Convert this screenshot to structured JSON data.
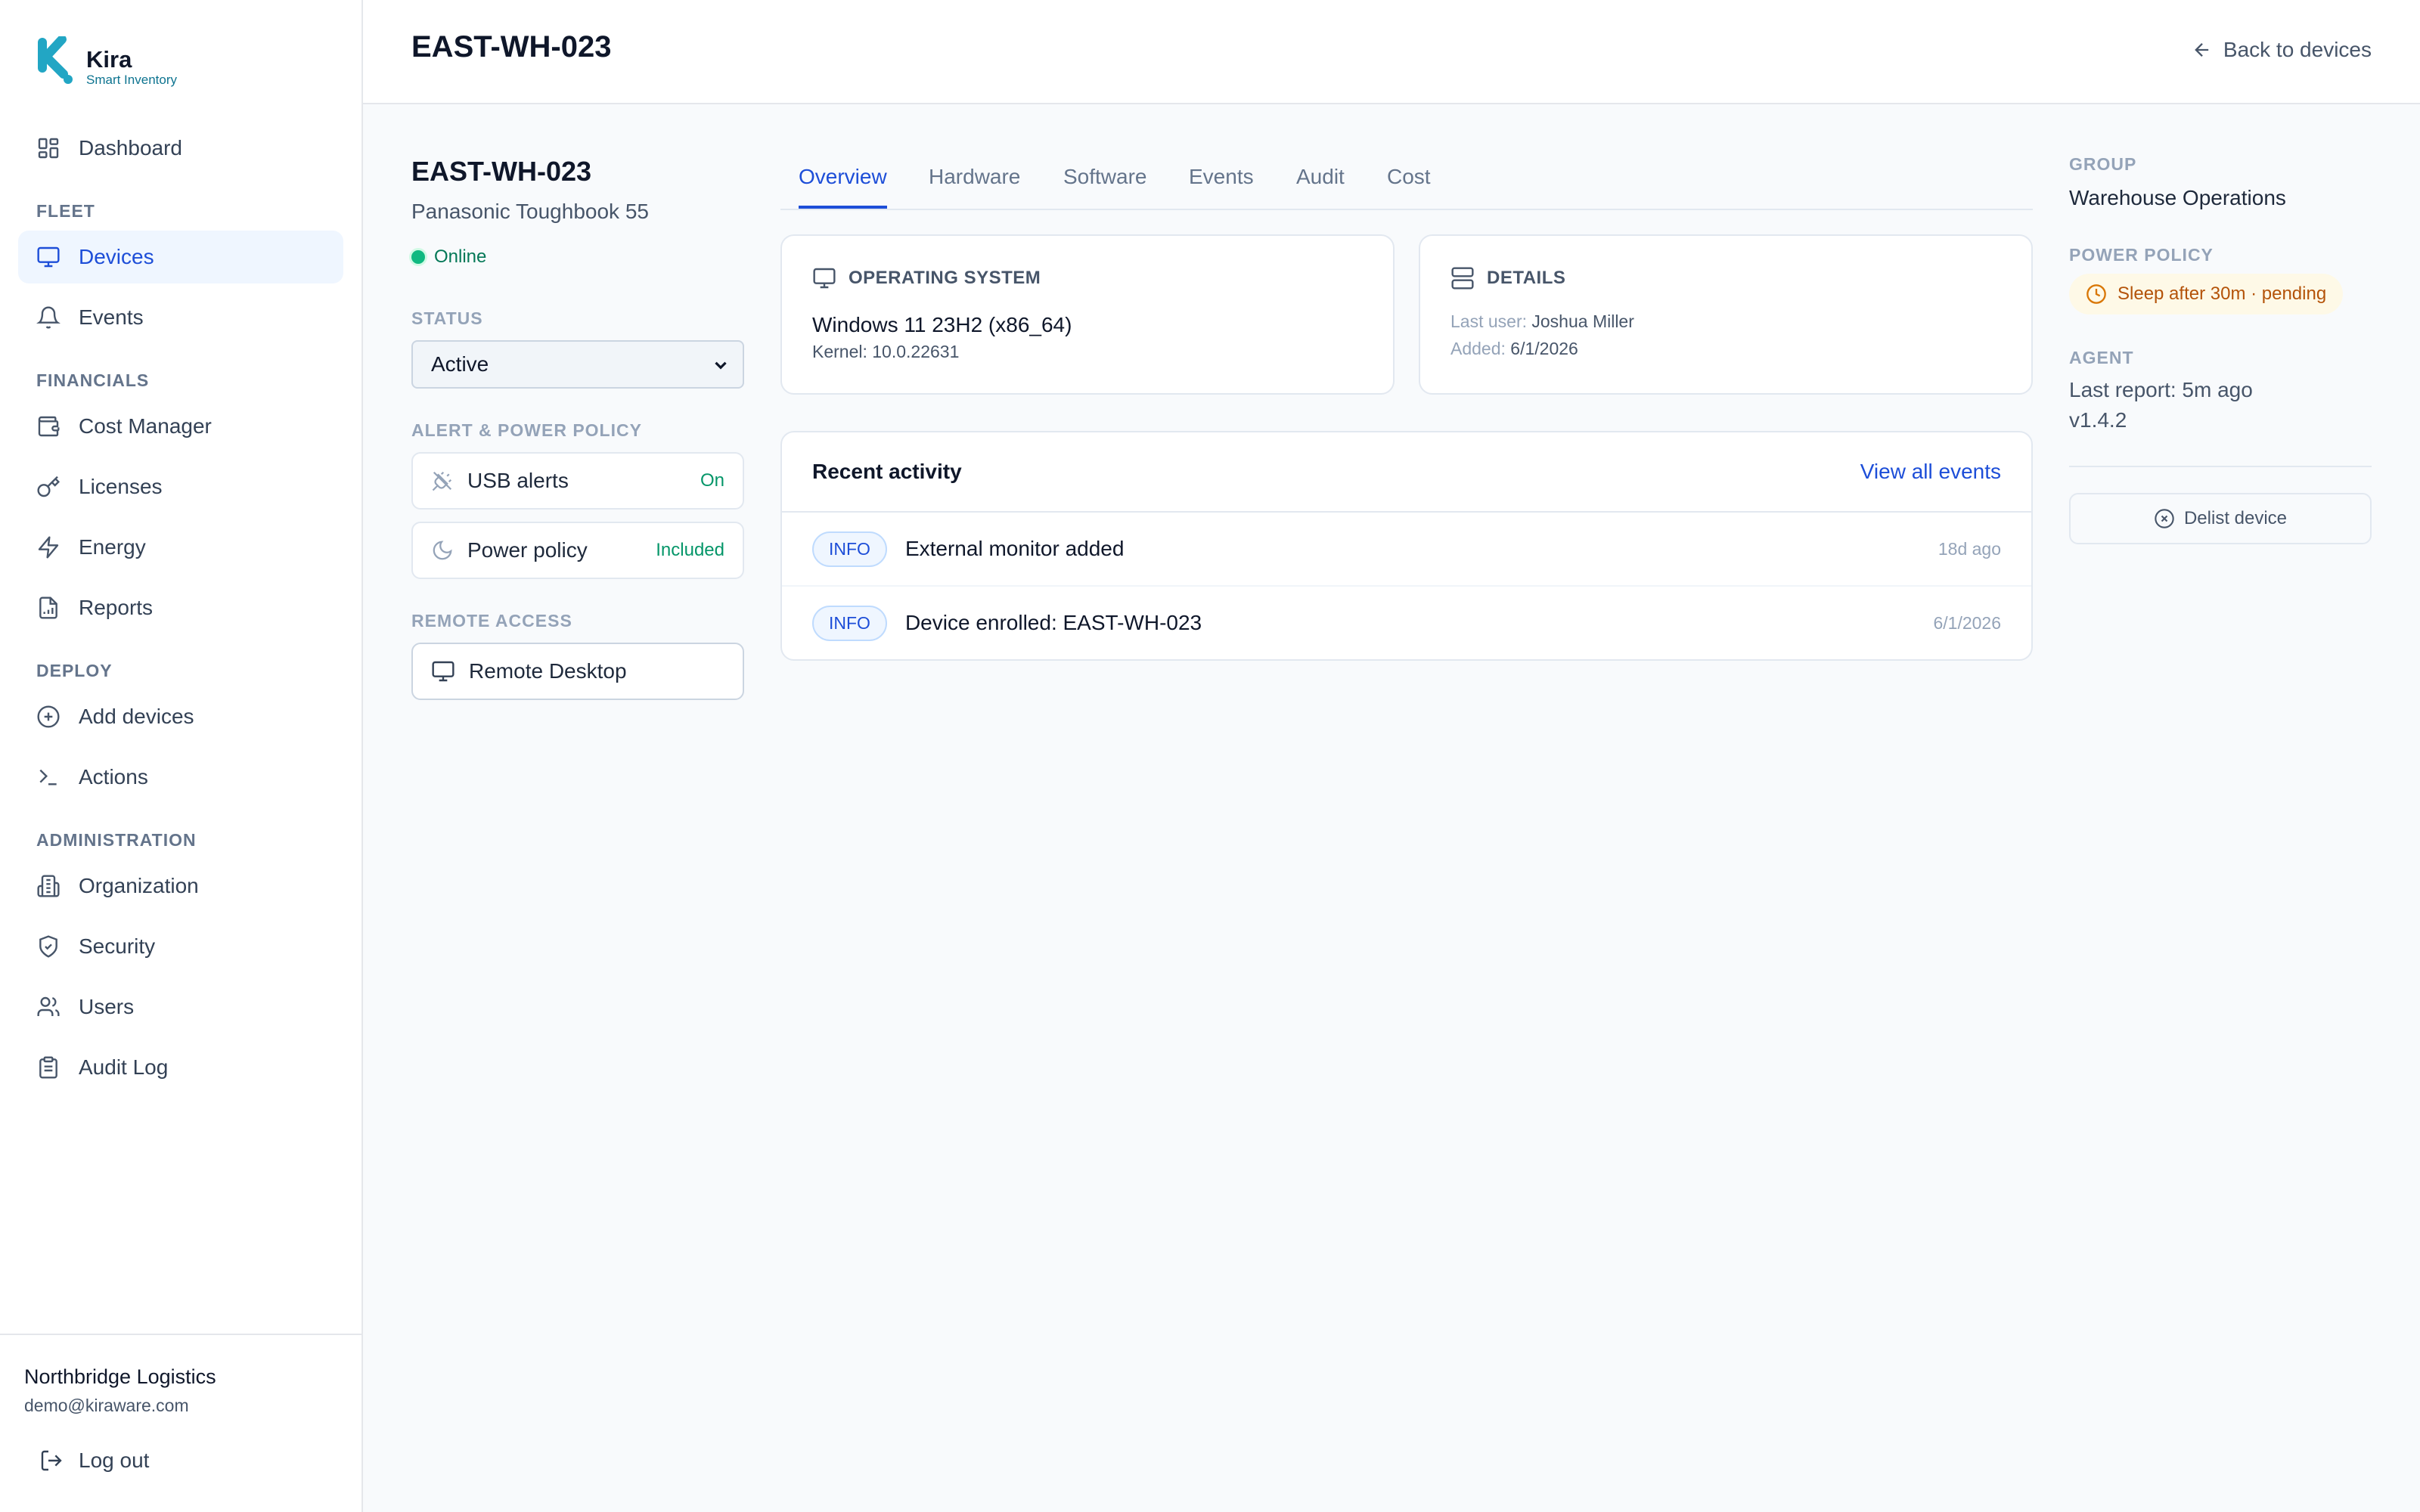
{
  "brand": {
    "name": "Kira",
    "tagline": "Smart Inventory",
    "accent": "#22a6c4"
  },
  "sidebar": {
    "items": [
      {
        "label": "Dashboard",
        "icon": "dashboard-icon"
      },
      {
        "label": "Devices",
        "icon": "monitor-icon",
        "active": true
      },
      {
        "label": "Events",
        "icon": "bell-icon"
      },
      {
        "label": "Cost Manager",
        "icon": "wallet-icon"
      },
      {
        "label": "Licenses",
        "icon": "key-icon"
      },
      {
        "label": "Energy",
        "icon": "zap-icon"
      },
      {
        "label": "Reports",
        "icon": "file-chart-icon"
      },
      {
        "label": "Add devices",
        "icon": "plus-circle-icon"
      },
      {
        "label": "Actions",
        "icon": "terminal-icon"
      },
      {
        "label": "Organization",
        "icon": "building-icon"
      },
      {
        "label": "Security",
        "icon": "shield-check-icon"
      },
      {
        "label": "Users",
        "icon": "users-icon"
      },
      {
        "label": "Audit Log",
        "icon": "clipboard-icon"
      }
    ],
    "sections": {
      "fleet": "FLEET",
      "financials": "FINANCIALS",
      "deploy": "DEPLOY",
      "administration": "ADMINISTRATION"
    },
    "footer": {
      "org": "Northbridge Logistics",
      "email": "demo@kiraware.com",
      "logout": "Log out"
    }
  },
  "header": {
    "title": "EAST-WH-023",
    "back": "Back to devices"
  },
  "device": {
    "name": "EAST-WH-023",
    "model": "Panasonic Toughbook 55",
    "state": "Online",
    "status_label": "STATUS",
    "status_value": "Active",
    "alert_label": "ALERT & POWER POLICY",
    "usb": {
      "label": "USB alerts",
      "value": "On"
    },
    "power": {
      "label": "Power policy",
      "value": "Included"
    },
    "remote_label": "REMOTE ACCESS",
    "remote_button": "Remote Desktop"
  },
  "tabs": [
    "Overview",
    "Hardware",
    "Software",
    "Events",
    "Audit",
    "Cost"
  ],
  "os_card": {
    "title": "OPERATING SYSTEM",
    "name": "Windows 11 23H2 (x86_64)",
    "kernel": "Kernel: 10.0.22631"
  },
  "details_card": {
    "title": "DETAILS",
    "last_user_label": "Last user:",
    "last_user": "Joshua Miller",
    "added_label": "Added:",
    "added": "6/1/2026"
  },
  "activity": {
    "title": "Recent activity",
    "view_all": "View all events",
    "rows": [
      {
        "level": "INFO",
        "text": "External monitor added",
        "time": "18d ago"
      },
      {
        "level": "INFO",
        "text": "Device enrolled: EAST-WH-023",
        "time": "6/1/2026"
      }
    ]
  },
  "side_info": {
    "group_label": "GROUP",
    "group": "Warehouse Operations",
    "power_label": "POWER POLICY",
    "power_pending": "Sleep after 30m · pending",
    "agent_label": "AGENT",
    "last_report": "Last report: 5m ago",
    "version": "v1.4.2",
    "delist": "Delist device"
  }
}
